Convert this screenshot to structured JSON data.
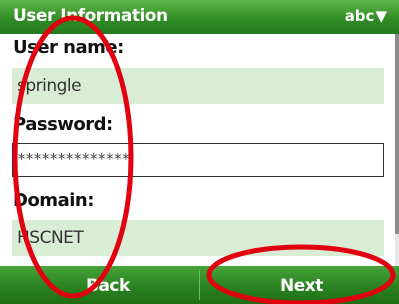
{
  "header": {
    "title": "User Information",
    "input_mode": "abc",
    "input_mode_icon": "input-mode-filter-icon"
  },
  "form": {
    "username_label": "User name:",
    "username_value": "springle",
    "password_label": "Password:",
    "password_value": "**************",
    "domain_label": "Domain:",
    "domain_value": "HSCNET"
  },
  "softkeys": {
    "left": "Back",
    "right": "Next"
  },
  "colors": {
    "accent_green": "#2f8a24",
    "field_fill": "#d9ecd4",
    "annotation_red": "#e0000f"
  }
}
